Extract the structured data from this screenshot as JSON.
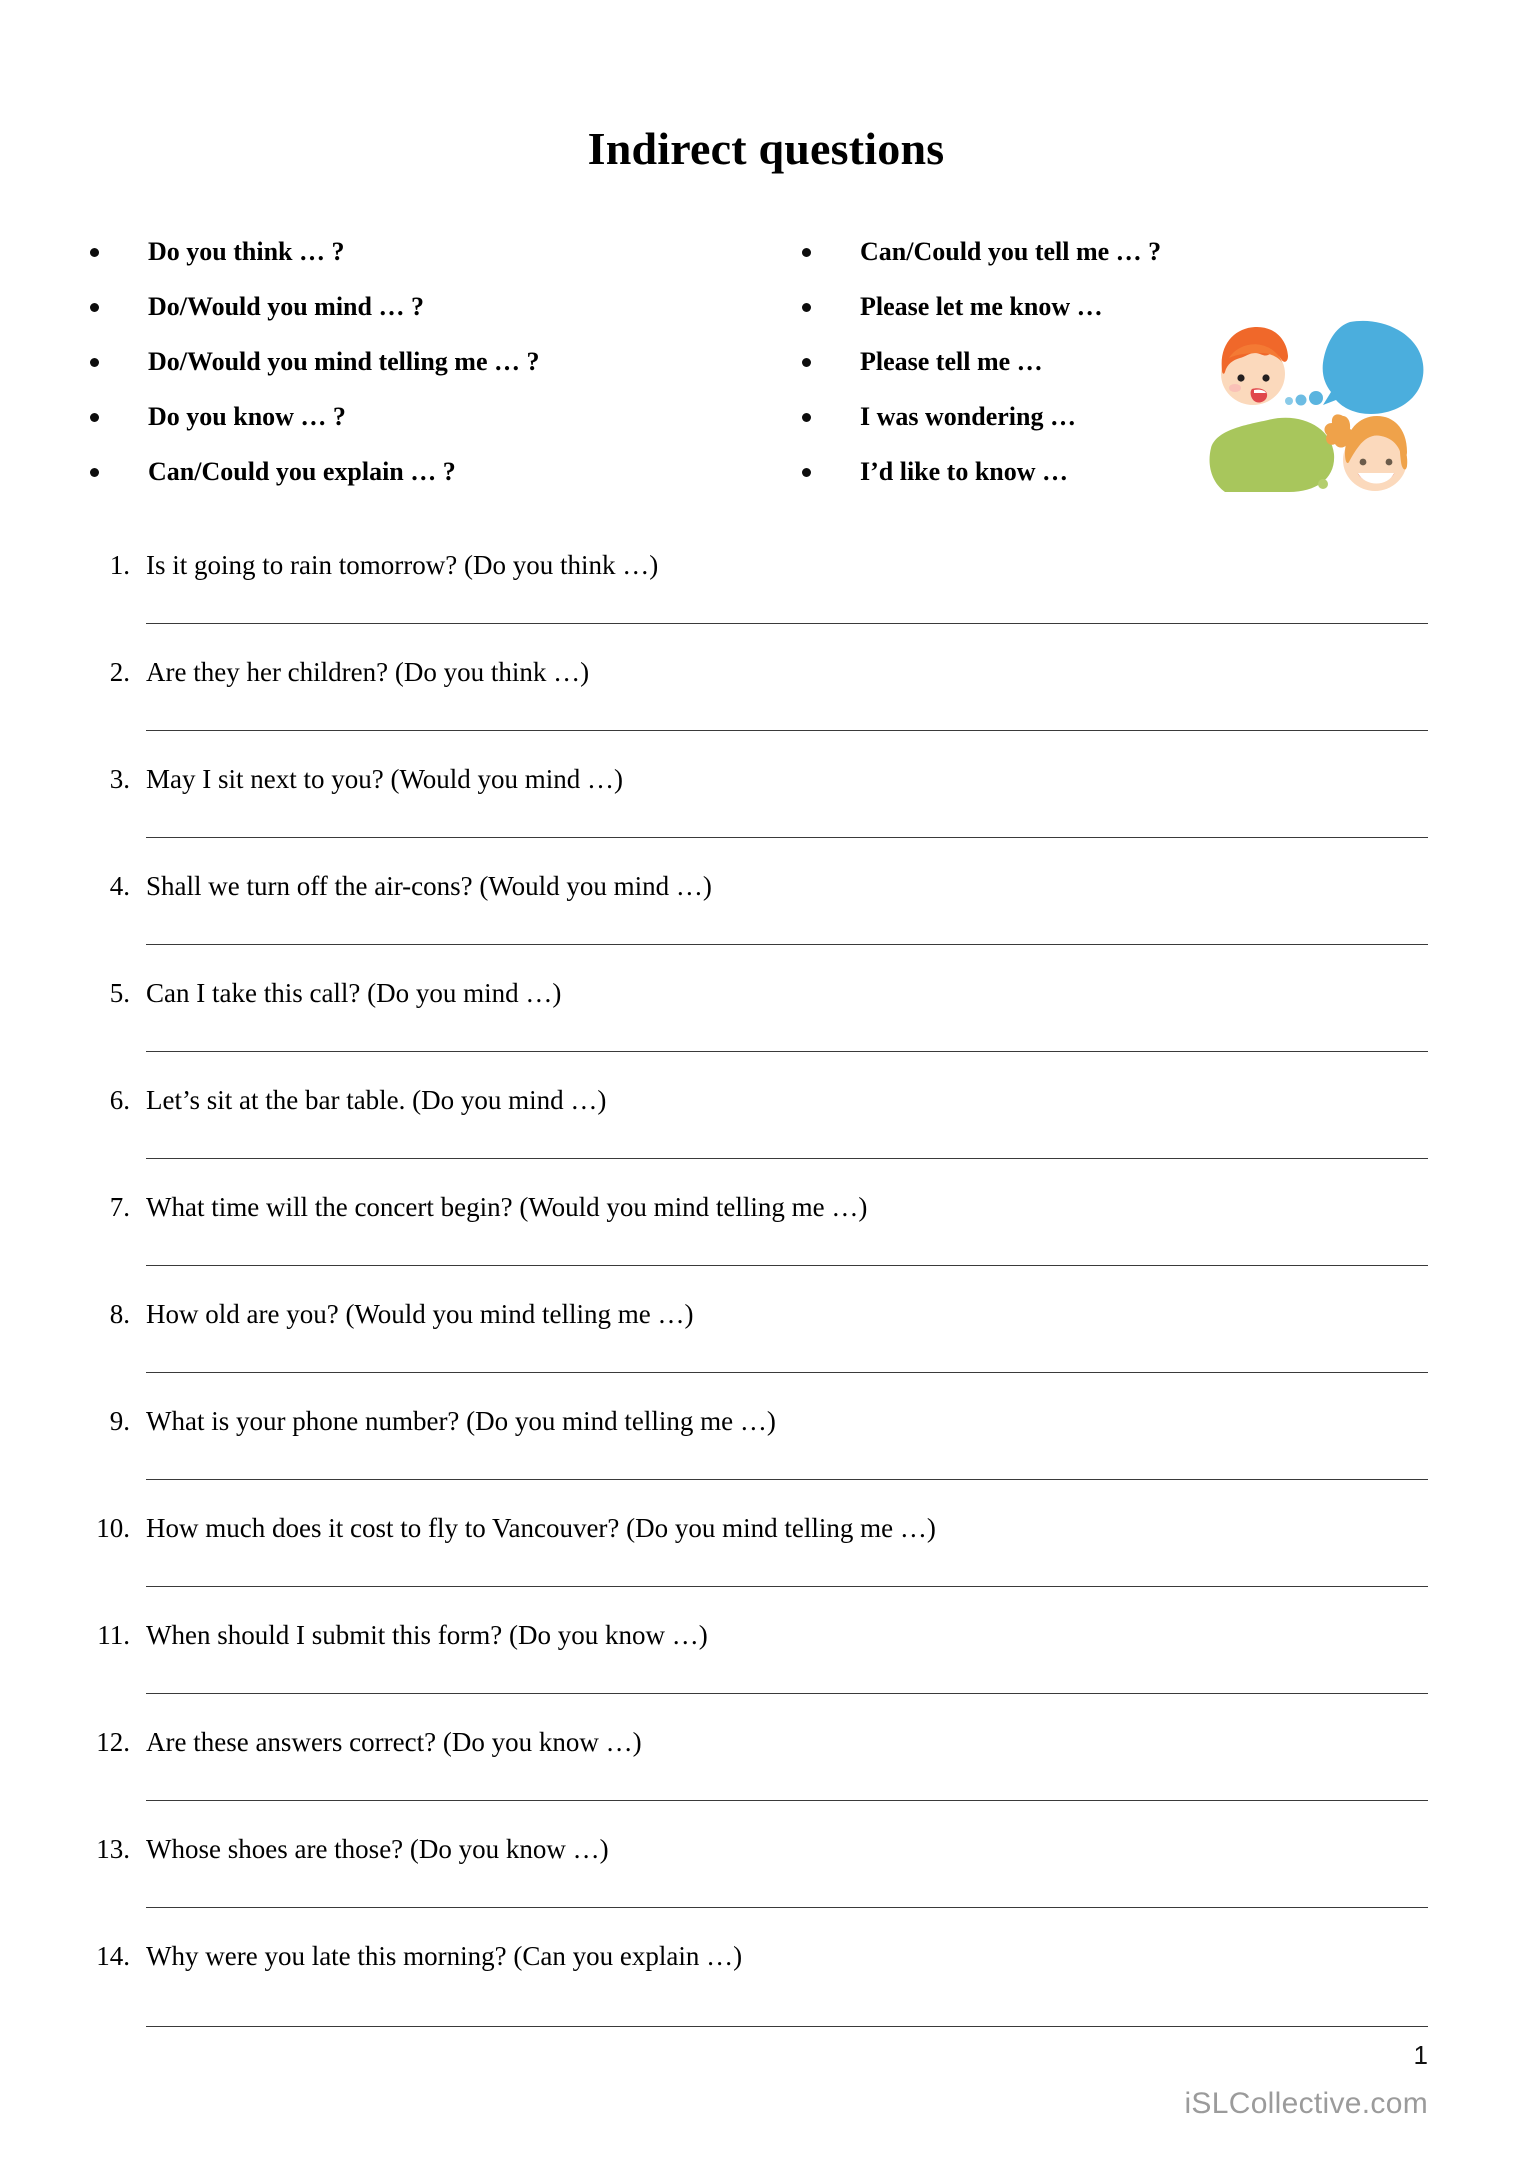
{
  "document": {
    "title": "Indirect questions"
  },
  "phrase_bank": {
    "left_column": [
      {
        "text": "Do you think … ?"
      },
      {
        "text": "Do/Would you mind … ?"
      },
      {
        "text": "Do/Would you mind telling me … ?"
      },
      {
        "text": "Do you know … ?"
      },
      {
        "text": "Can/Could you explain … ?"
      }
    ],
    "right_column": [
      {
        "text": "Can/Could you tell me … ?"
      },
      {
        "text": "Please let me know …"
      },
      {
        "text": "Please tell me …"
      },
      {
        "text": "I was wondering …"
      },
      {
        "text": "I’d like to know …"
      }
    ]
  },
  "illustration": {
    "name": "two-children-thought-bubbles-clipart",
    "colors": {
      "blue_bubble": "#4BAEDD",
      "green_bubble": "#A8C65C",
      "boy_hair": "#F0682A",
      "girl_hair": "#EFA24A",
      "skin": "#FBD9BC",
      "mouth_red": "#E0484C"
    }
  },
  "exercises": [
    {
      "number": "1.",
      "text": "Is it going to rain tomorrow? (Do you think …)"
    },
    {
      "number": "2.",
      "text": "Are they her children? (Do you think …)"
    },
    {
      "number": "3.",
      "text": "May I sit next to you? (Would you mind …)"
    },
    {
      "number": "4.",
      "text": "Shall we turn off the air-cons? (Would you mind …)"
    },
    {
      "number": "5.",
      "text": "Can I take this call? (Do you mind …)"
    },
    {
      "number": "6.",
      "text": "Let’s sit at the bar table. (Do you mind …)"
    },
    {
      "number": "7.",
      "text": "What time will the concert begin? (Would you mind telling me …)"
    },
    {
      "number": "8.",
      "text": "How old are you? (Would you mind telling me …)"
    },
    {
      "number": "9.",
      "text": "What is your phone number? (Do you mind telling me …)"
    },
    {
      "number": "10.",
      "text": "How much does it cost to fly to Vancouver? (Do you mind telling me …)"
    },
    {
      "number": "11.",
      "text": "When should I submit this form? (Do you know …)"
    },
    {
      "number": "12.",
      "text": "Are these answers correct? (Do you know …)"
    },
    {
      "number": "13.",
      "text": "Whose shoes are those? (Do you know …)"
    },
    {
      "number": "14.",
      "text": "Why were you late this morning? (Can you explain …)"
    }
  ],
  "footer": {
    "page_number": "1",
    "watermark": "iSLCollective.com"
  }
}
